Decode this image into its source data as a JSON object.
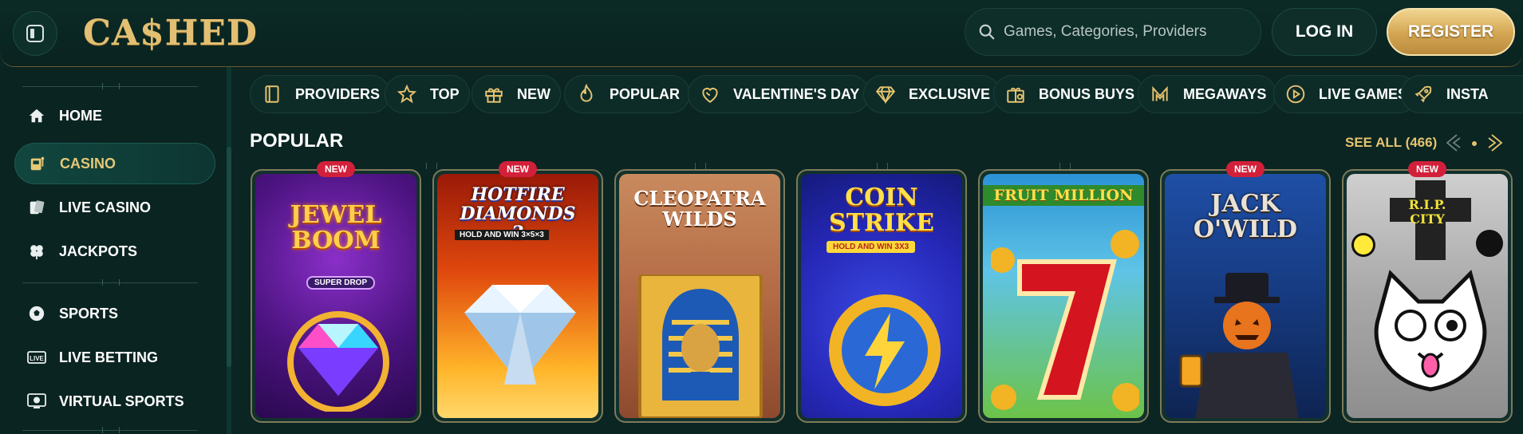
{
  "header": {
    "logo": "CA$HED",
    "search_placeholder": "Games, Categories, Providers",
    "login": "LOG IN",
    "register": "REGISTER"
  },
  "sidebar": {
    "items": [
      {
        "label": "HOME",
        "icon": "home-icon"
      },
      {
        "label": "CASINO",
        "icon": "slot-machine-icon",
        "active": true
      },
      {
        "label": "LIVE CASINO",
        "icon": "cards-icon"
      },
      {
        "label": "JACKPOTS",
        "icon": "clover-icon"
      },
      {
        "label": "SPORTS",
        "icon": "soccer-ball-icon"
      },
      {
        "label": "LIVE BETTING",
        "icon": "live-icon"
      },
      {
        "label": "VIRTUAL SPORTS",
        "icon": "virtual-sports-icon"
      }
    ]
  },
  "categories": [
    {
      "label": "PROVIDERS",
      "icon": "book-icon"
    },
    {
      "label": "TOP",
      "icon": "star-icon"
    },
    {
      "label": "NEW",
      "icon": "gift-icon"
    },
    {
      "label": "POPULAR",
      "icon": "flame-icon"
    },
    {
      "label": "VALENTINE'S DAY",
      "icon": "heart-icon"
    },
    {
      "label": "EXCLUSIVE",
      "icon": "diamond-icon"
    },
    {
      "label": "BONUS BUYS",
      "icon": "bonus-gift-icon"
    },
    {
      "label": "MEGAWAYS",
      "icon": "megaways-icon"
    },
    {
      "label": "LIVE GAMES",
      "icon": "play-icon"
    },
    {
      "label": "INSTA",
      "icon": "rocket-icon"
    }
  ],
  "section": {
    "title": "POPULAR",
    "see_all": "SEE ALL (466)"
  },
  "games": [
    {
      "title": "JEWEL BOOM",
      "subtitle": "SUPER DROP",
      "badge": "NEW"
    },
    {
      "title": "HOTFIRE DIAMONDS 2",
      "subtitle": "HOLD AND WIN 3×5×3",
      "badge": "NEW"
    },
    {
      "title": "CLEOPATRA WILDS",
      "subtitle": "",
      "badge": ""
    },
    {
      "title": "COIN STRIKE",
      "subtitle": "HOLD AND WIN 3X3",
      "badge": ""
    },
    {
      "title": "FRUIT MILLION",
      "subtitle": "",
      "badge": ""
    },
    {
      "title": "JACK O'WILD",
      "subtitle": "",
      "badge": "NEW"
    },
    {
      "title": "R.I.P. CITY",
      "subtitle": "",
      "badge": "NEW"
    }
  ],
  "colors": {
    "accent_gold": "#e6c36f",
    "background": "#0a2522",
    "badge_red": "#d3203a"
  }
}
